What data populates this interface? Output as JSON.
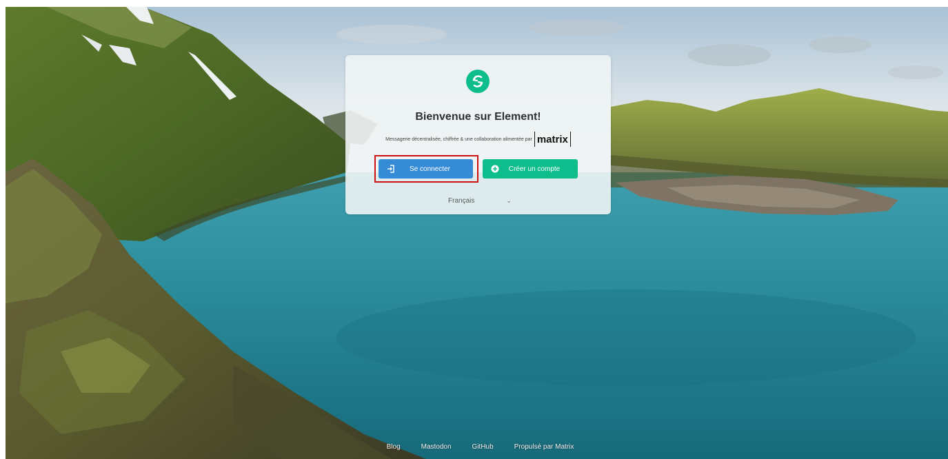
{
  "welcome": {
    "title": "Bienvenue sur Element!",
    "subtitle": "Messagerie décentralisée, chiffrée & une collaboration alimentée par",
    "matrix_logo_text": "matrix",
    "logo_icon": "element-logo-icon"
  },
  "buttons": {
    "login_label": "Se connecter",
    "login_icon": "sign-in-icon",
    "register_label": "Créer un compte",
    "register_icon": "plus-circle-icon"
  },
  "language": {
    "selected": "Français"
  },
  "footer": {
    "links": [
      "Blog",
      "Mastodon",
      "GitHub",
      "Propulsé par Matrix"
    ]
  },
  "colors": {
    "brand_green": "#0dbd8b",
    "login_blue": "#368bd6",
    "highlight_red": "#cc1010"
  }
}
